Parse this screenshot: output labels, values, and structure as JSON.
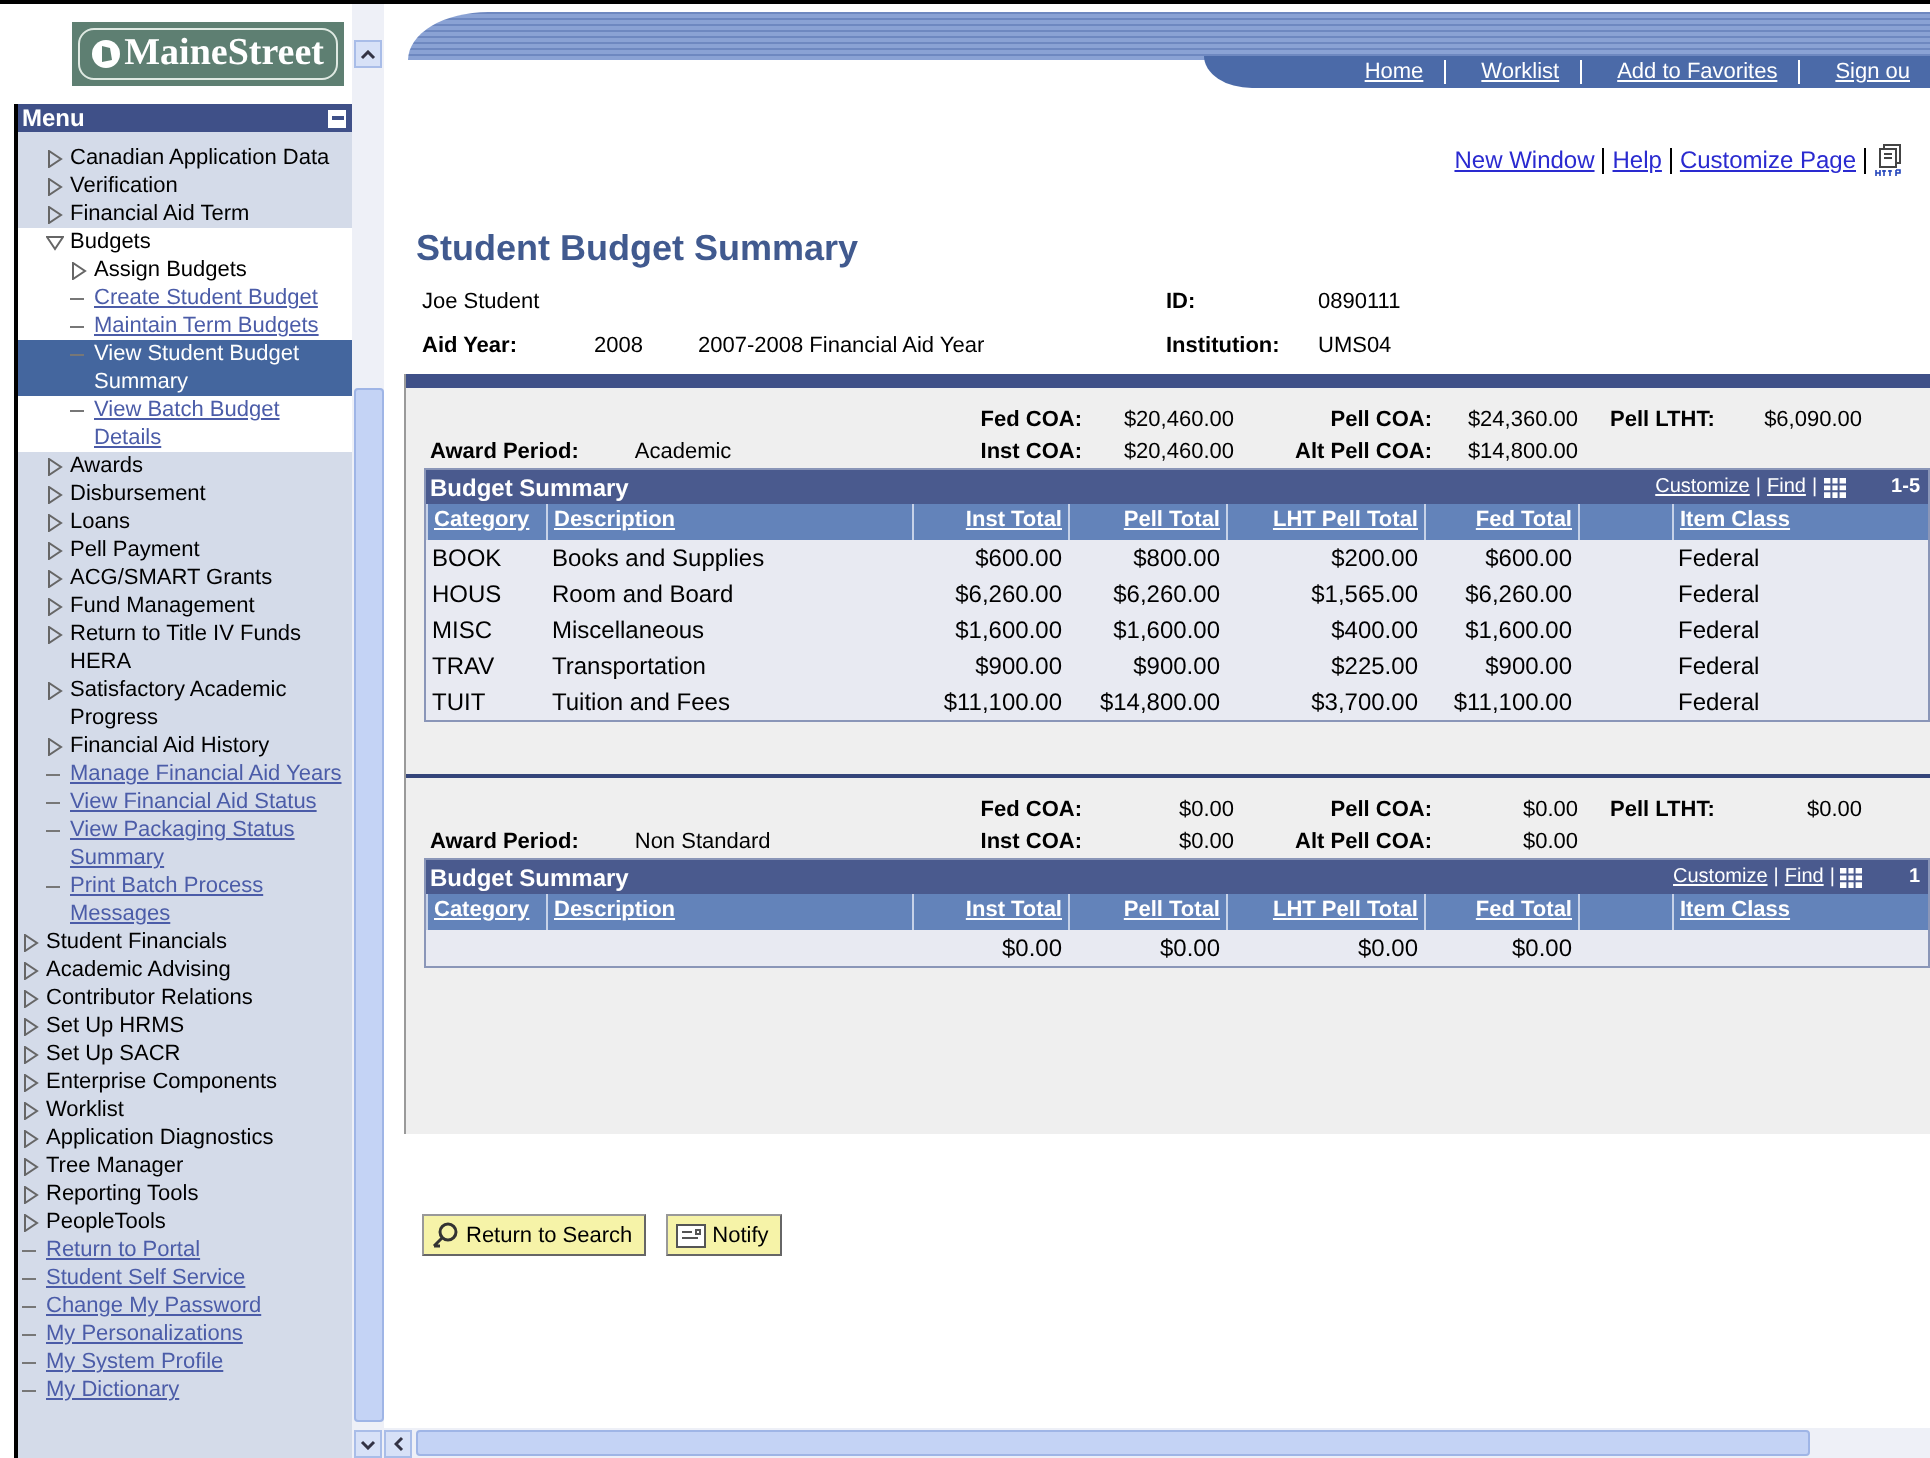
{
  "logo": {
    "text": "MaineStreet"
  },
  "menu": {
    "title": "Menu",
    "scrolled_group": {
      "children": [
        {
          "label": "Canadian Application Data",
          "kind": "folder",
          "expanded": false,
          "selected": false
        },
        {
          "label": "Verification",
          "kind": "folder",
          "expanded": false,
          "selected": false
        },
        {
          "label": "Financial Aid Term",
          "kind": "folder",
          "expanded": false,
          "selected": false
        },
        {
          "label": "Budgets",
          "kind": "folder",
          "expanded": true,
          "selected": false,
          "children": [
            {
              "label": "Assign Budgets",
              "kind": "folder",
              "expanded": false,
              "selected": false
            },
            {
              "label": "Create Student Budget",
              "kind": "link",
              "selected": false
            },
            {
              "label": "Maintain Term Budgets",
              "kind": "link",
              "selected": false
            },
            {
              "label": "View Student Budget Summary",
              "kind": "link",
              "selected": true
            },
            {
              "label": "View Batch Budget Details",
              "kind": "link",
              "selected": false
            }
          ]
        },
        {
          "label": "Awards",
          "kind": "folder",
          "expanded": false,
          "selected": false
        },
        {
          "label": "Disbursement",
          "kind": "folder",
          "expanded": false,
          "selected": false
        },
        {
          "label": "Loans",
          "kind": "folder",
          "expanded": false,
          "selected": false
        },
        {
          "label": "Pell Payment",
          "kind": "folder",
          "expanded": false,
          "selected": false
        },
        {
          "label": "ACG/SMART Grants",
          "kind": "folder",
          "expanded": false,
          "selected": false
        },
        {
          "label": "Fund Management",
          "kind": "folder",
          "expanded": false,
          "selected": false
        },
        {
          "label": "Return to Title IV Funds HERA",
          "kind": "folder",
          "expanded": false,
          "selected": false
        },
        {
          "label": "Satisfactory Academic Progress",
          "kind": "folder",
          "expanded": false,
          "selected": false
        },
        {
          "label": "Financial Aid History",
          "kind": "folder",
          "expanded": false,
          "selected": false
        },
        {
          "label": "Manage Financial Aid Years",
          "kind": "link",
          "selected": false
        },
        {
          "label": "View Financial Aid Status",
          "kind": "link",
          "selected": false
        },
        {
          "label": "View Packaging Status Summary",
          "kind": "link",
          "selected": false
        },
        {
          "label": "Print Batch Process Messages",
          "kind": "link",
          "selected": false
        }
      ]
    },
    "items": [
      {
        "label": "Student Financials",
        "kind": "folder",
        "expanded": false,
        "selected": false
      },
      {
        "label": "Academic Advising",
        "kind": "folder",
        "expanded": false,
        "selected": false
      },
      {
        "label": "Contributor Relations",
        "kind": "folder",
        "expanded": false,
        "selected": false
      },
      {
        "label": "Set Up HRMS",
        "kind": "folder",
        "expanded": false,
        "selected": false
      },
      {
        "label": "Set Up SACR",
        "kind": "folder",
        "expanded": false,
        "selected": false
      },
      {
        "label": "Enterprise Components",
        "kind": "folder",
        "expanded": false,
        "selected": false
      },
      {
        "label": "Worklist",
        "kind": "folder",
        "expanded": false,
        "selected": false
      },
      {
        "label": "Application Diagnostics",
        "kind": "folder",
        "expanded": false,
        "selected": false
      },
      {
        "label": "Tree Manager",
        "kind": "folder",
        "expanded": false,
        "selected": false
      },
      {
        "label": "Reporting Tools",
        "kind": "folder",
        "expanded": false,
        "selected": false
      },
      {
        "label": "PeopleTools",
        "kind": "folder",
        "expanded": false,
        "selected": false
      },
      {
        "label": "Return to Portal",
        "kind": "link",
        "selected": false
      },
      {
        "label": "Student Self Service",
        "kind": "link",
        "selected": false
      },
      {
        "label": "Change My Password",
        "kind": "link",
        "selected": false
      },
      {
        "label": "My Personalizations",
        "kind": "link",
        "selected": false
      },
      {
        "label": "My System Profile",
        "kind": "link",
        "selected": false
      },
      {
        "label": "My Dictionary",
        "kind": "link",
        "selected": false
      }
    ]
  },
  "nav_links": [
    "Home",
    "Worklist",
    "Add to Favorites",
    "Sign ou"
  ],
  "page_links": [
    "New Window",
    "Help",
    "Customize Page"
  ],
  "title": "Student Budget Summary",
  "student": {
    "name": "Joe Student",
    "id_label": "ID:",
    "id": "0890111",
    "aid_year_label": "Aid Year:",
    "aid_year": "2008",
    "aid_year_desc": "2007-2008 Financial Aid Year",
    "institution_label": "Institution:",
    "institution": "UMS04"
  },
  "periods": [
    {
      "label": "Award Period:",
      "value": "Academic",
      "coa": [
        [
          {
            "label": "Fed COA:",
            "value": "$20,460.00"
          },
          {
            "label": "Pell COA:",
            "value": "$24,360.00"
          },
          {
            "label": "Pell LTHT:",
            "value": "$6,090.00"
          }
        ],
        [
          {
            "label": "Inst COA:",
            "value": "$20,460.00"
          },
          {
            "label": "Alt Pell COA:",
            "value": "$14,800.00"
          }
        ]
      ],
      "grid": {
        "title": "Budget Summary",
        "links": [
          "Customize",
          "Find"
        ],
        "separator": "|",
        "count": "1-5",
        "columns": [
          "Category",
          "Description",
          "Inst Total",
          "Pell Total",
          "LHT Pell Total",
          "Fed Total",
          "Item Class"
        ],
        "rows": [
          [
            "BOOK",
            "Books and Supplies",
            "$600.00",
            "$800.00",
            "$200.00",
            "$600.00",
            "Federal"
          ],
          [
            "HOUS",
            "Room and Board",
            "$6,260.00",
            "$6,260.00",
            "$1,565.00",
            "$6,260.00",
            "Federal"
          ],
          [
            "MISC",
            "Miscellaneous",
            "$1,600.00",
            "$1,600.00",
            "$400.00",
            "$1,600.00",
            "Federal"
          ],
          [
            "TRAV",
            "Transportation",
            "$900.00",
            "$900.00",
            "$225.00",
            "$900.00",
            "Federal"
          ],
          [
            "TUIT",
            "Tuition and Fees",
            "$11,100.00",
            "$14,800.00",
            "$3,700.00",
            "$11,100.00",
            "Federal"
          ]
        ]
      }
    },
    {
      "label": "Award Period:",
      "value": "Non Standard",
      "coa": [
        [
          {
            "label": "Fed COA:",
            "value": "$0.00"
          },
          {
            "label": "Pell COA:",
            "value": "$0.00"
          },
          {
            "label": "Pell LTHT:",
            "value": "$0.00"
          }
        ],
        [
          {
            "label": "Inst COA:",
            "value": "$0.00"
          },
          {
            "label": "Alt Pell COA:",
            "value": "$0.00"
          }
        ]
      ],
      "grid": {
        "title": "Budget Summary",
        "links": [
          "Customize",
          "Find"
        ],
        "separator": "|",
        "count": "1",
        "columns": [
          "Category",
          "Description",
          "Inst Total",
          "Pell Total",
          "LHT Pell Total",
          "Fed Total",
          "Item Class"
        ],
        "rows": [
          [
            null,
            null,
            "$0.00",
            "$0.00",
            "$0.00",
            "$0.00",
            null
          ]
        ]
      }
    }
  ],
  "buttons": [
    {
      "label": "Return to Search",
      "kind": "search"
    },
    {
      "label": "Notify",
      "kind": "notify"
    }
  ]
}
